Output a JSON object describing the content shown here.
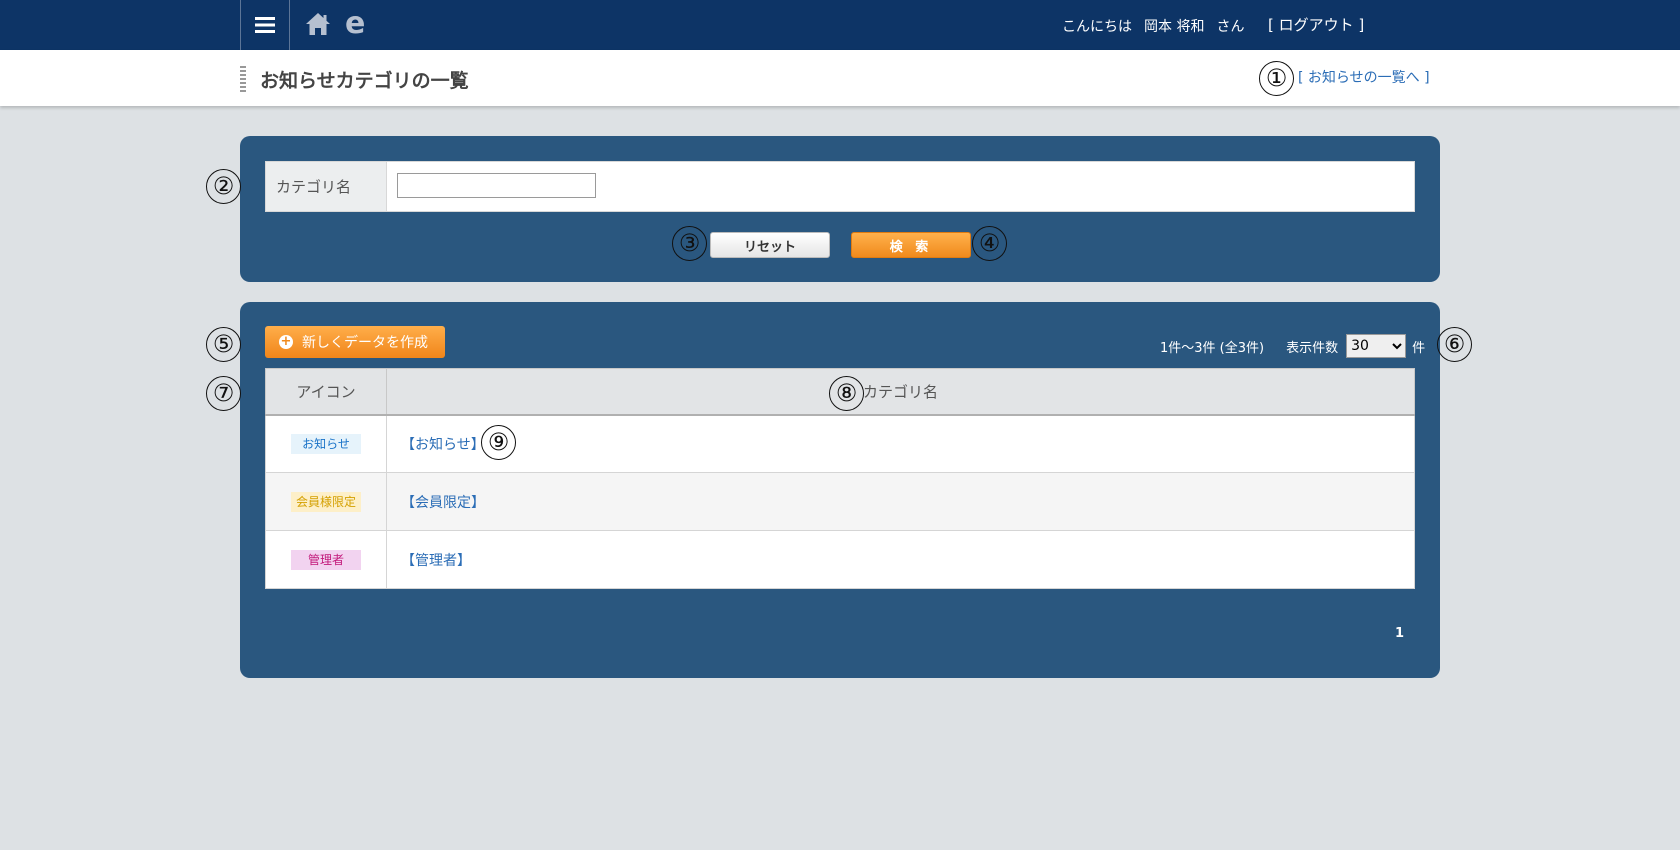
{
  "header": {
    "greeting": "こんにちは",
    "user_name": "岡本 将和",
    "honorific": "さん",
    "logout_label": "[ ログアウト ]",
    "logo_letter": "e"
  },
  "titlebar": {
    "page_title": "お知らせカテゴリの一覧",
    "list_link": "[ お知らせの一覧へ ]"
  },
  "search": {
    "field_label": "カテゴリ名",
    "field_value": "",
    "reset_label": "リセット",
    "search_label": "検 索"
  },
  "list": {
    "create_label": "新しくデータを作成",
    "range_text": "1件～3件 (全3件)",
    "per_page_label": "表示件数",
    "per_page_value": "30",
    "per_page_unit": "件",
    "columns": {
      "icon": "アイコン",
      "name": "カテゴリ名"
    },
    "rows": [
      {
        "badge": "お知らせ",
        "badge_color": "#1a73c8",
        "badge_bg": "#e6f3fb",
        "name": "【お知らせ】"
      },
      {
        "badge": "会員様限定",
        "badge_color": "#d4a000",
        "badge_bg": "#fdefc8",
        "name": "【会員限定】"
      },
      {
        "badge": "管理者",
        "badge_color": "#c2187a",
        "badge_bg": "#f2d3f0",
        "name": "【管理者】"
      }
    ],
    "pager": "1"
  },
  "annotations": [
    "①",
    "②",
    "③",
    "④",
    "⑤",
    "⑥",
    "⑦",
    "⑧",
    "⑨"
  ]
}
